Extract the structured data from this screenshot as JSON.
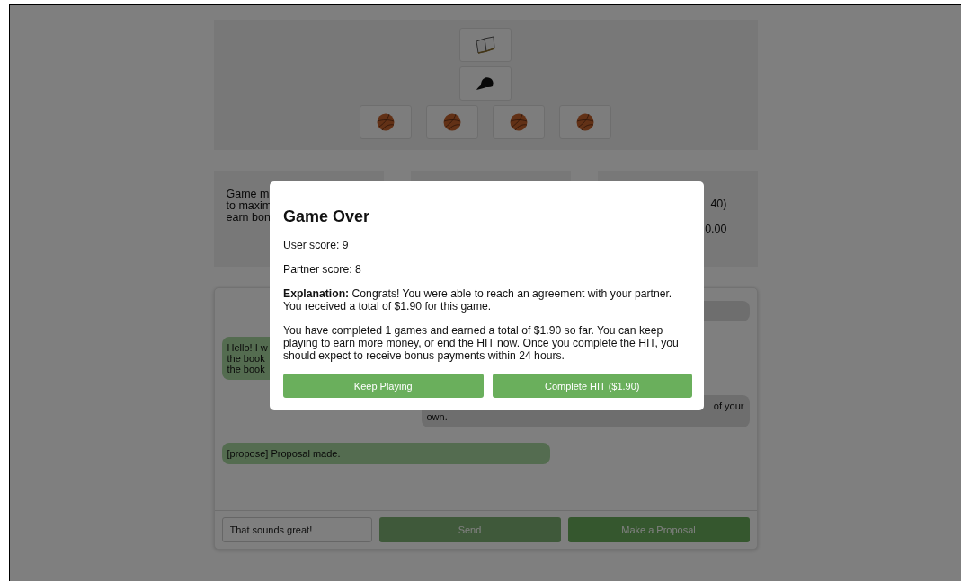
{
  "item_rows": [
    {
      "items": [
        {
          "kind": "book"
        }
      ]
    },
    {
      "items": [
        {
          "kind": "hat"
        }
      ]
    },
    {
      "items": [
        {
          "kind": "ball"
        },
        {
          "kind": "ball"
        },
        {
          "kind": "ball"
        },
        {
          "kind": "ball"
        }
      ]
    }
  ],
  "info_panels": [
    {
      "lines": [
        {
          "text": "Game m"
        },
        {
          "text": "to maxim"
        },
        {
          "text": "earn bon"
        }
      ]
    },
    {
      "lines": [
        {
          "text": "40)",
          "cut_start": true
        },
        {
          "text": "0.00",
          "cut_start": true
        }
      ]
    }
  ],
  "chat": {
    "messages": [
      {
        "kind": "partner"
      },
      {
        "kind": "user",
        "lines": [
          {
            "text": "Hello! I w"
          },
          {
            "text": "the book"
          },
          {
            "text": "the book"
          }
        ]
      },
      {
        "kind": "partner",
        "lines": [
          {
            "text": "of your",
            "cut_start": true
          },
          {
            "text": "own.",
            "cut_start": false
          }
        ]
      },
      {
        "kind": "user",
        "lines": [
          {
            "text": "[propose] Proposal made."
          }
        ]
      }
    ],
    "input": {
      "value": "That sounds great!"
    },
    "buttons": [
      {
        "label": "Send",
        "disabled": true
      },
      {
        "label": "Make a Proposal",
        "disabled": false
      }
    ]
  },
  "modal": {
    "title": "Game Over",
    "paragraphs": [
      "User score: 9",
      "Partner score: 8",
      "**Explanation:** Congrats! You were able to reach an agreement with your partner. You received a total of $1.90 for this game.",
      "You have completed 1 games and earned a total of $1.90 so far. You can keep playing to earn more money, or end the HIT now. Once you complete the HIT, you should expect to receive bonus payments within 24 hours."
    ],
    "buttons": [
      {
        "label": "Keep Playing"
      },
      {
        "label": "Complete HIT ($1.90)"
      }
    ]
  }
}
